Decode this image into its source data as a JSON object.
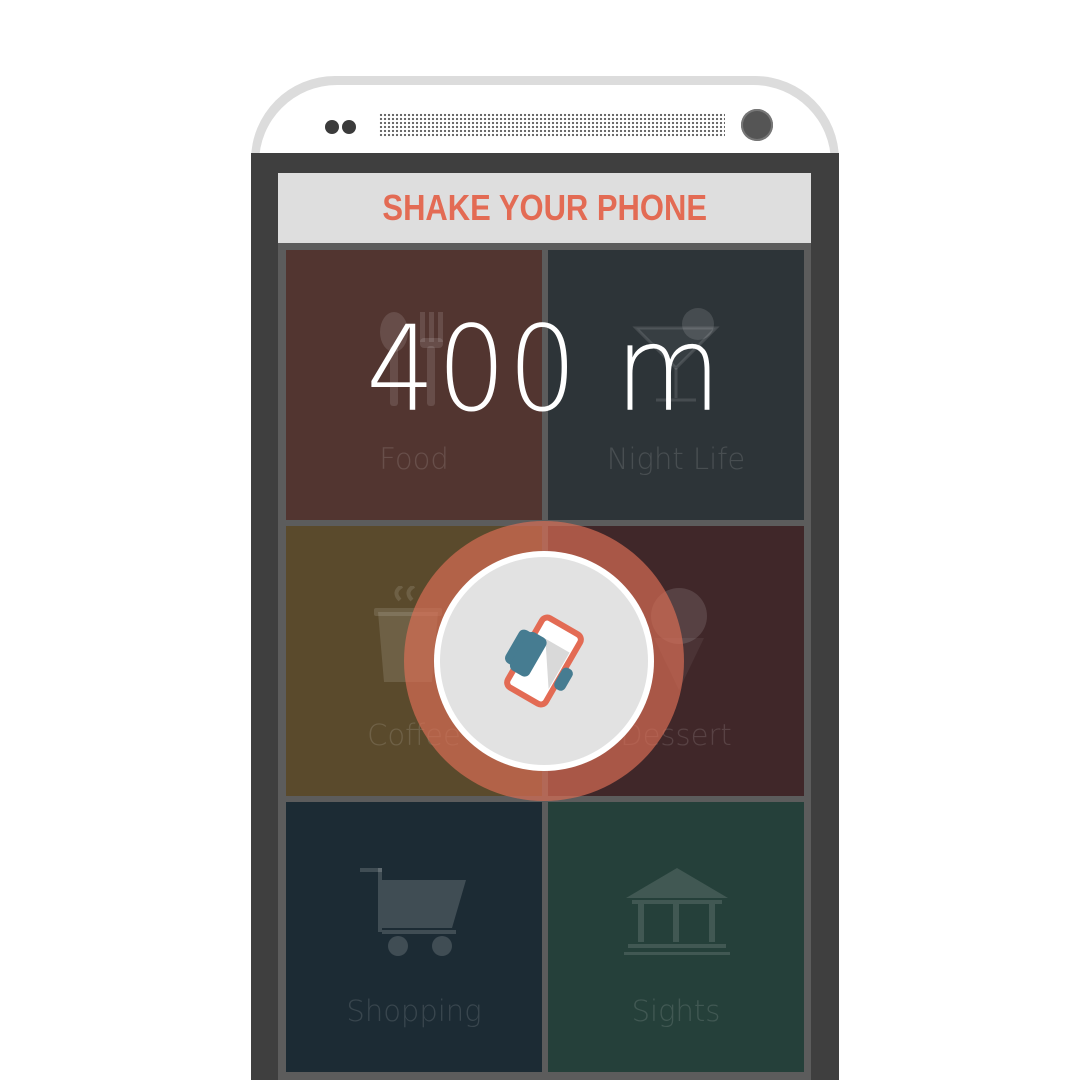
{
  "header": {
    "title": "SHAKE YOUR PHONE"
  },
  "distance": {
    "value": "400 m"
  },
  "categories": [
    {
      "label": "Food",
      "icon": "cutlery-icon",
      "color": "#523530"
    },
    {
      "label": "Night  Life",
      "icon": "cocktail-icon",
      "color": "#2d3438"
    },
    {
      "label": "Coffee",
      "icon": "coffee-cup-icon",
      "color": "#5a4a2c"
    },
    {
      "label": "Dessert",
      "icon": "ice-cream-icon",
      "color": "#402729"
    },
    {
      "label": "Shopping",
      "icon": "shopping-cart-icon",
      "color": "#1c2b34"
    },
    {
      "label": "Sights",
      "icon": "landmark-icon",
      "color": "#25403a"
    }
  ],
  "shake_button": {
    "icon": "shake-phone-icon",
    "accent": "#e36b54",
    "secondary": "#467c91"
  }
}
